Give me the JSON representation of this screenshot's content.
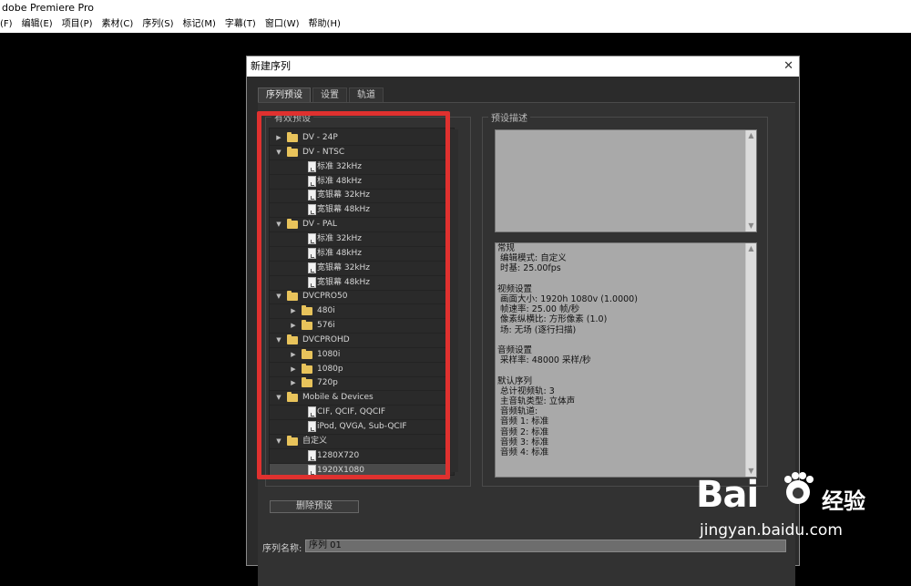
{
  "window": {
    "title": "dobe Premiere Pro"
  },
  "menubar": [
    "(F)",
    "编辑(E)",
    "项目(P)",
    "素材(C)",
    "序列(S)",
    "标记(M)",
    "字幕(T)",
    "窗口(W)",
    "帮助(H)"
  ],
  "dialog": {
    "title": "新建序列",
    "close": "✕",
    "tabs": [
      "序列预设",
      "设置",
      "轨道"
    ],
    "active_tab": "序列预设",
    "presets_group_label": "有效预设",
    "description_group_label": "预设描述",
    "tree": [
      {
        "type": "folder",
        "label": "DV - 24P",
        "expanded": false,
        "level": 0
      },
      {
        "type": "folder",
        "label": "DV - NTSC",
        "expanded": true,
        "level": 0
      },
      {
        "type": "file",
        "label": "标准 32kHz",
        "level": 1
      },
      {
        "type": "file",
        "label": "标准 48kHz",
        "level": 1
      },
      {
        "type": "file",
        "label": "宽银幕 32kHz",
        "level": 1
      },
      {
        "type": "file",
        "label": "宽银幕 48kHz",
        "level": 1
      },
      {
        "type": "folder",
        "label": "DV - PAL",
        "expanded": true,
        "level": 0
      },
      {
        "type": "file",
        "label": "标准 32kHz",
        "level": 1
      },
      {
        "type": "file",
        "label": "标准 48kHz",
        "level": 1
      },
      {
        "type": "file",
        "label": "宽银幕 32kHz",
        "level": 1
      },
      {
        "type": "file",
        "label": "宽银幕 48kHz",
        "level": 1
      },
      {
        "type": "folder",
        "label": "DVCPRO50",
        "expanded": true,
        "level": 0
      },
      {
        "type": "folder",
        "label": "480i",
        "expanded": false,
        "level": 1
      },
      {
        "type": "folder",
        "label": "576i",
        "expanded": false,
        "level": 1
      },
      {
        "type": "folder",
        "label": "DVCPROHD",
        "expanded": true,
        "level": 0
      },
      {
        "type": "folder",
        "label": "1080i",
        "expanded": false,
        "level": 1
      },
      {
        "type": "folder",
        "label": "1080p",
        "expanded": false,
        "level": 1
      },
      {
        "type": "folder",
        "label": "720p",
        "expanded": false,
        "level": 1
      },
      {
        "type": "folder",
        "label": "Mobile & Devices",
        "expanded": true,
        "level": 0
      },
      {
        "type": "file",
        "label": "CIF, QCIF, QQCIF",
        "level": 1
      },
      {
        "type": "file",
        "label": "iPod, QVGA, Sub-QCIF",
        "level": 1
      },
      {
        "type": "folder",
        "label": "自定义",
        "expanded": true,
        "level": 0
      },
      {
        "type": "file",
        "label": "1280X720",
        "level": 1
      },
      {
        "type": "file",
        "label": "1920X1080",
        "level": 1,
        "selected": true
      }
    ],
    "description_lines": [
      "常规",
      " 编辑模式: 自定义",
      " 时基: 25.00fps",
      "",
      "视频设置",
      " 画面大小: 1920h 1080v (1.0000)",
      " 帧速率: 25.00 帧/秒",
      " 像素纵横比: 方形像素 (1.0)",
      " 场: 无场 (逐行扫描)",
      "",
      "音频设置",
      " 采样率: 48000 采样/秒",
      "",
      "默认序列",
      " 总计视频轨: 3",
      " 主音轨类型: 立体声",
      " 音频轨道:",
      " 音频 1: 标准",
      " 音频 2: 标准",
      " 音频 3: 标准",
      " 音频 4: 标准"
    ],
    "delete_preset_label": "删除预设",
    "sequence_name_label": "序列名称:",
    "sequence_name_value": "序列 01"
  },
  "watermark": {
    "logo": "Bai",
    "logo_suffix": "经验",
    "url": "jingyan.baidu.com"
  },
  "colors": {
    "highlight": "#e0312f",
    "folder": "#e8c35b",
    "dialog_bg": "#2b2b2b"
  }
}
